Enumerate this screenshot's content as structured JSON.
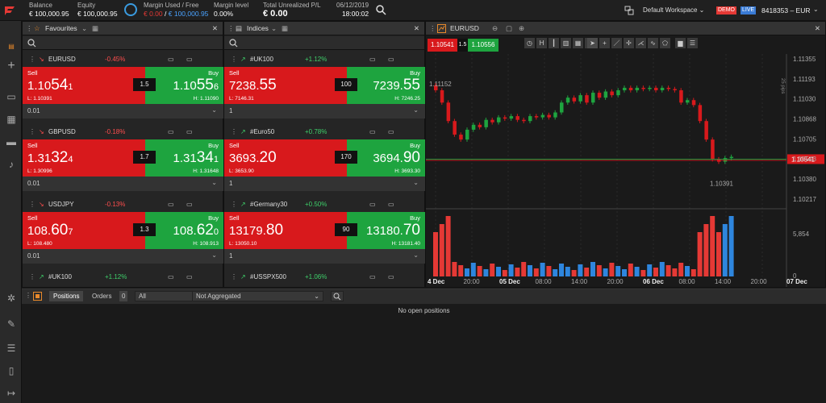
{
  "top": {
    "balance_label": "Balance",
    "balance_value": "€ 100,000.95",
    "equity_label": "Equity",
    "equity_value": "€ 100,000.95",
    "margin_label": "Margin Used / Free",
    "margin_used": "€ 0.00",
    "margin_sep": "/",
    "margin_free": "€ 100,000.95",
    "level_label": "Margin level",
    "level_value": "0.00%",
    "pl_label": "Total Unrealized P/L",
    "pl_value": "€ 0.00",
    "date": "06/12/2019",
    "time": "18:00:02",
    "workspace": "Default Workspace",
    "demo_badge": "DEMO",
    "live_badge": "LIVE",
    "account": "8418353 – EUR"
  },
  "panels": [
    {
      "title": "Favourites",
      "cards": [
        {
          "symbol": "EURUSD",
          "change": "-0.45%",
          "dir": "dn",
          "sell": "Sell",
          "buy": "Buy",
          "bid_a": "1.10",
          "bid_b": "54",
          "bid_c": "1",
          "ask_a": "1.10",
          "ask_b": "55",
          "ask_c": "6",
          "spread": "1.5",
          "low": "L: 1.10391",
          "high": "H: 1.11090",
          "qty": "0.01"
        },
        {
          "symbol": "GBPUSD",
          "change": "-0.18%",
          "dir": "dn",
          "sell": "Sell",
          "buy": "Buy",
          "bid_a": "1.31",
          "bid_b": "32",
          "bid_c": "4",
          "ask_a": "1.31",
          "ask_b": "34",
          "ask_c": "1",
          "spread": "1.7",
          "low": "L: 1.30996",
          "high": "H: 1.31648",
          "qty": "0.01"
        },
        {
          "symbol": "USDJPY",
          "change": "-0.13%",
          "dir": "dn",
          "sell": "Sell",
          "buy": "Buy",
          "bid_a": "108.",
          "bid_b": "60",
          "bid_c": "7",
          "ask_a": "108.",
          "ask_b": "62",
          "ask_c": "0",
          "spread": "1.3",
          "low": "L: 108.480",
          "high": "H: 108.913",
          "qty": "0.01"
        }
      ],
      "next": {
        "symbol": "#UK100",
        "change": "+1.12%",
        "dir": "up"
      }
    },
    {
      "title": "Indices",
      "cards": [
        {
          "symbol": "#UK100",
          "change": "+1.12%",
          "dir": "up",
          "sell": "Sell",
          "buy": "Buy",
          "bid_a": "7238.",
          "bid_b": "55",
          "bid_c": "",
          "ask_a": "7239.",
          "ask_b": "55",
          "ask_c": "",
          "spread": "100",
          "low": "L: 7146.31",
          "high": "H: 7246.25",
          "qty": "1"
        },
        {
          "symbol": "#Euro50",
          "change": "+0.78%",
          "dir": "up",
          "sell": "Sell",
          "buy": "Buy",
          "bid_a": "3693.",
          "bid_b": "20",
          "bid_c": "",
          "ask_a": "3694.",
          "ask_b": "90",
          "ask_c": "",
          "spread": "170",
          "low": "L: 3653.90",
          "high": "H: 3693.30",
          "qty": "1"
        },
        {
          "symbol": "#Germany30",
          "change": "+0.50%",
          "dir": "up",
          "sell": "Sell",
          "buy": "Buy",
          "bid_a": "13179.",
          "bid_b": "80",
          "bid_c": "",
          "ask_a": "13180.",
          "ask_b": "70",
          "ask_c": "",
          "spread": "90",
          "low": "L: 13050.10",
          "high": "H: 13181.40",
          "qty": "1"
        }
      ],
      "next": {
        "symbol": "#USSPX500",
        "change": "+1.06%",
        "dir": "up"
      }
    }
  ],
  "chart": {
    "symbol": "EURUSD",
    "sell_price": "1.10541",
    "spread": "1.5",
    "buy_price": "1.10556",
    "pips_label": "25 pips",
    "high_label": "1.11152",
    "low_label": "1.10391",
    "price_tag": "1.10541",
    "y_ticks": [
      "1.11355",
      "1.11193",
      "1.11030",
      "1.10868",
      "1.10705",
      "1.10543",
      "1.10380",
      "1.10217"
    ],
    "vol_ticks": [
      "5,854",
      "0"
    ],
    "x_ticks": [
      "4 Dec",
      "20:00",
      "05 Dec",
      "08:00",
      "14:00",
      "20:00",
      "06 Dec",
      "08:00",
      "14:00",
      "20:00",
      "07 Dec"
    ],
    "colors": {
      "up": "#1ea43f",
      "down": "#d8191c",
      "vol_up": "#2e86de",
      "vol_down": "#e53935"
    }
  },
  "bottom": {
    "positions_tab": "Positions",
    "orders_tab": "Orders",
    "orders_count": "0",
    "filter": "All",
    "aggregation": "Not Aggregated",
    "empty_text": "No open positions"
  }
}
